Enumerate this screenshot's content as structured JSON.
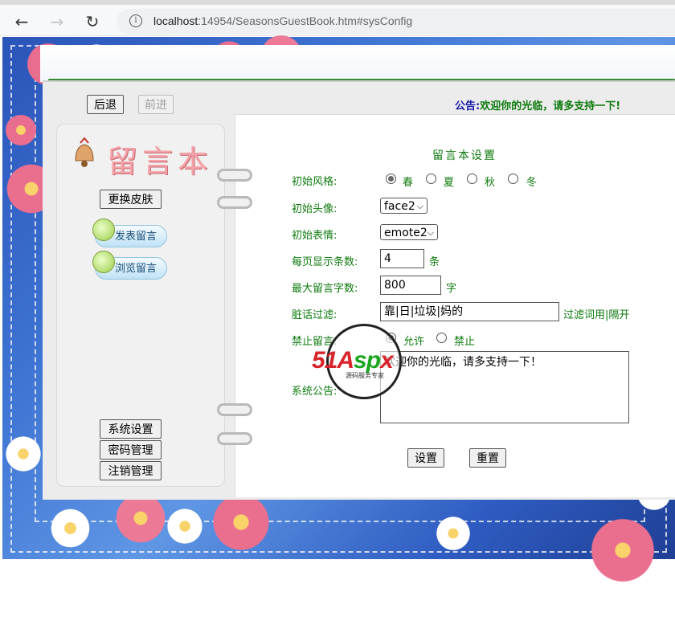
{
  "browser": {
    "url_host": "localhost",
    "url_rest": ":14954/SeasonsGuestBook.htm#sysConfig",
    "back_icon": "arrow-left-icon",
    "forward_icon": "arrow-right-icon",
    "reload_icon": "reload-icon",
    "info_icon": "info-icon"
  },
  "nav": {
    "back_label": "后退",
    "forward_label": "前进"
  },
  "notice": {
    "label": "公告:",
    "text": "欢迎你的光临，请多支持一下!"
  },
  "sidebar": {
    "logo_text": "留言本",
    "skin_button": "更换皮肤",
    "post_label": "发表留言",
    "browse_label": "浏览留言",
    "system_settings": "系统设置",
    "password_manage": "密码管理",
    "logout_manage": "注销管理"
  },
  "form": {
    "title": "留言本设置",
    "style_label": "初始风格:",
    "seasons": [
      "春",
      "夏",
      "秋",
      "冬"
    ],
    "selected_season": "春",
    "avatar_label": "初始头像:",
    "avatar_value": "face2",
    "emote_label": "初始表情:",
    "emote_value": "emote2",
    "per_page_label": "每页显示条数:",
    "per_page_value": "4",
    "per_page_unit": "条",
    "max_chars_label": "最大留言字数:",
    "max_chars_value": "800",
    "max_chars_unit": "字",
    "filter_label": "脏话过滤:",
    "filter_value": "靠|日|垃圾|妈的",
    "filter_hint": "过滤词用|隔开",
    "ban_label": "禁止留言:",
    "ban_options": [
      "允许",
      "禁止"
    ],
    "ban_selected": "允许",
    "announce_label": "系统公告:",
    "announce_value": "欢迎你的光临，请多支持一下！",
    "submit_label": "设置",
    "reset_label": "重置"
  },
  "watermark": {
    "brand_red": "51A",
    "brand_green": "sp",
    "brand_red2": "x",
    "subtitle": "源码服务专家"
  },
  "colors": {
    "label_green": "#0d7a0d",
    "frame_blue": "#2f5cc2",
    "notice_blue": "#1a1aa6"
  }
}
